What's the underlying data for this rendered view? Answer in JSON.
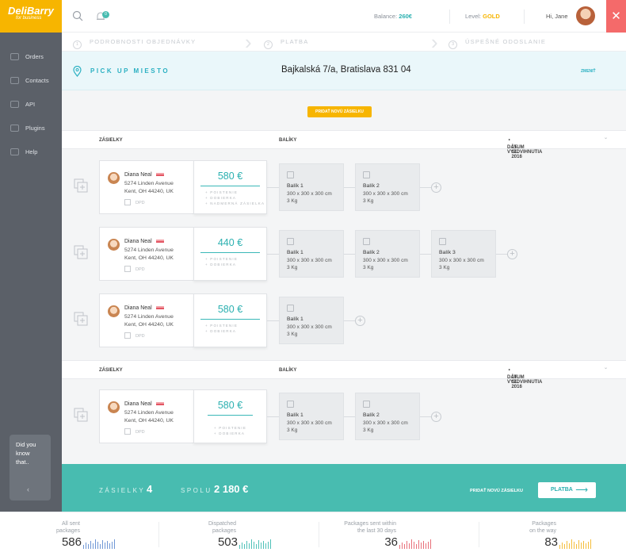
{
  "brand": {
    "name": "DeliBarry",
    "tagline": "for business"
  },
  "sidebar": {
    "items": [
      {
        "label": "Orders",
        "icon": "orders-icon"
      },
      {
        "label": "Contacts",
        "icon": "contacts-icon"
      },
      {
        "label": "API",
        "icon": "api-icon"
      },
      {
        "label": "Plugins",
        "icon": "plugins-icon"
      },
      {
        "label": "Help",
        "icon": "help-icon"
      }
    ],
    "tip": {
      "line1": "Did you",
      "line2": "know",
      "line3": "that..",
      "collapse": "‹"
    }
  },
  "header": {
    "notifications_count": "0",
    "balance_label": "Balance:",
    "balance_value": "260€",
    "level_label": "Level:",
    "level_value": "GOLD",
    "greeting": "Hi, Jane",
    "close": "✕"
  },
  "steps": [
    {
      "num": "1",
      "label": "PODROBNOSTI OBJEDNÁVKY"
    },
    {
      "num": "2",
      "label": "PLATBA"
    },
    {
      "num": "3",
      "label": "ÚSPEŠNÉ ODOSLANIE"
    }
  ],
  "pickup": {
    "label": "PICK UP MIESTO",
    "address": "Bajkalská 7/a, Bratislava 831 04",
    "change": "ZMENIŤ"
  },
  "add_shipment_top": "PRIDAŤ NOVÚ ZÁSIELKU",
  "groups": [
    {
      "col_shipments": "ZÁSIELKY",
      "col_packages": "BALÍKY",
      "date_label": "DÁTUM VYZDVIHNUTIA",
      "date_value": "15. 01. 2016",
      "caret": "⌄"
    },
    {
      "col_shipments": "ZÁSIELKY",
      "col_packages": "BALÍKY",
      "date_label": "DÁTUM VYZDVIHNUTIA",
      "date_value": "10. 01. 2016",
      "caret": "⌄"
    }
  ],
  "shipments": [
    {
      "name": "Diana Neal",
      "street": "5274 Linden Avenue",
      "city": "Kent, OH 44240, UK",
      "carrier": "DPD",
      "price": "580 €",
      "extras": [
        "+ POISTENIE",
        "+ DOBIERKA",
        "+ NADMERNÁ ZÁSIELKA"
      ],
      "packages": [
        {
          "name": "Balík 1",
          "dims": "300 x 300 x 300 cm",
          "weight": "3 Kg"
        },
        {
          "name": "Balík 2",
          "dims": "300 x 300 x 300 cm",
          "weight": "3 Kg"
        }
      ]
    },
    {
      "name": "Diana Neal",
      "street": "5274 Linden Avenue",
      "city": "Kent, OH 44240, UK",
      "carrier": "DPD",
      "price": "440 €",
      "extras": [
        "+ POISTENIE",
        "+ DOBIERKA"
      ],
      "packages": [
        {
          "name": "Balík 1",
          "dims": "300 x 300 x 300 cm",
          "weight": "3 Kg"
        },
        {
          "name": "Balík 2",
          "dims": "300 x 300 x 300 cm",
          "weight": "3 Kg"
        },
        {
          "name": "Balík 3",
          "dims": "300 x 300 x 300 cm",
          "weight": "3 Kg"
        }
      ]
    },
    {
      "name": "Diana Neal",
      "street": "5274 Linden Avenue",
      "city": "Kent, OH 44240, UK",
      "carrier": "DPD",
      "price": "580 €",
      "extras": [
        "+ POISTENIE",
        "+ DOBIERKA"
      ],
      "packages": [
        {
          "name": "Balík 1",
          "dims": "300 x 300 x 300 cm",
          "weight": "3 Kg"
        }
      ]
    },
    {
      "name": "Diana Neal",
      "street": "5274 Linden Avenue",
      "city": "Kent, OH 44240, UK",
      "carrier": "DPD",
      "price": "580 €",
      "extras": [
        "+ POISTENIE",
        "+ DOBIERKA"
      ],
      "packages": [
        {
          "name": "Balík 1",
          "dims": "300 x 300 x 300 cm",
          "weight": "3 Kg"
        },
        {
          "name": "Balík 2",
          "dims": "300 x 300 x 300 cm",
          "weight": "3 Kg"
        }
      ]
    }
  ],
  "summary": {
    "shipments_label": "ZÁSIELKY",
    "shipments_count": "4",
    "total_label": "SPOLU",
    "total_value": "2 180 €",
    "add_label": "PRIDAŤ NOVÚ ZÁSIELKU",
    "pay_label": "PLATBA",
    "pay_arrow": "⟶"
  },
  "stats": [
    {
      "label_line1": "All sent",
      "label_line2": "packages",
      "value": "586",
      "color": "#6f97d6"
    },
    {
      "label_line1": "Dispatched",
      "label_line2": "packages",
      "value": "503",
      "color": "#4fc1b8"
    },
    {
      "label_line1": "Packages sent within",
      "label_line2": "the last 30 days",
      "value": "36",
      "color": "#e8707a"
    },
    {
      "label_line1": "Packages",
      "label_line2": "on the way",
      "value": "83",
      "color": "#f5be3c"
    }
  ],
  "colors": {
    "accent": "#2bb0b0",
    "brand": "#f7b500",
    "sidebar": "#5b6068",
    "summary": "#48bcb0",
    "close": "#f46a6a"
  }
}
